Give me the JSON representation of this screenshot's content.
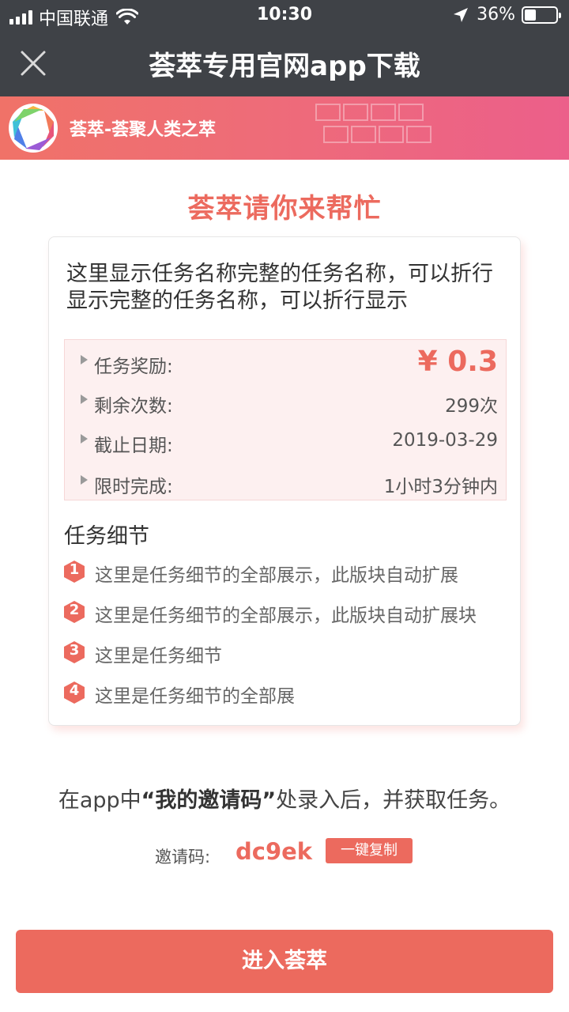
{
  "status_bar": {
    "carrier": "中国联通",
    "time": "10:30",
    "battery_percent": "36%",
    "battery_level": 0.36,
    "icons": [
      "signal-icon",
      "wifi-icon",
      "location-arrow-icon",
      "battery-icon"
    ]
  },
  "nav": {
    "title": "荟萃专用官网app下载",
    "close_icon": "close-icon"
  },
  "banner": {
    "text": "荟萃-荟聚人类之萃"
  },
  "headline": "荟萃请你来帮忙",
  "task": {
    "title": "这里显示任务名称完整的任务名称，可以折行显示完整的任务名称，可以折行显示",
    "info": [
      {
        "label": "任务奖励:",
        "value": "¥ 0.3"
      },
      {
        "label": "剩余次数:",
        "value": "299次"
      },
      {
        "label": "截止日期:",
        "value": "2019-03-29"
      },
      {
        "label": "限时完成:",
        "value": "1小时3分钟内"
      }
    ],
    "details_heading": "任务细节",
    "details": [
      {
        "num": "1",
        "text": "这里是任务细节的全部展示，此版块自动扩展"
      },
      {
        "num": "2",
        "text": "这里是任务细节的全部展示，此版块自动扩展块"
      },
      {
        "num": "3",
        "text": "这里是任务细节"
      },
      {
        "num": "4",
        "text": "这里是任务细节的全部展"
      }
    ]
  },
  "invite": {
    "desc_prefix": "在app中",
    "desc_quote": "“我的邀请码”",
    "desc_suffix": "处录入后，并获取任务。",
    "code_label": "邀请码:",
    "code_value": "dc9ek",
    "copy_label": "一键复制"
  },
  "enter_button": "进入荟萃",
  "colors": {
    "accent": "#ec6a5e",
    "nav_bg": "#3f4247",
    "info_bg": "#fdf0f0"
  }
}
